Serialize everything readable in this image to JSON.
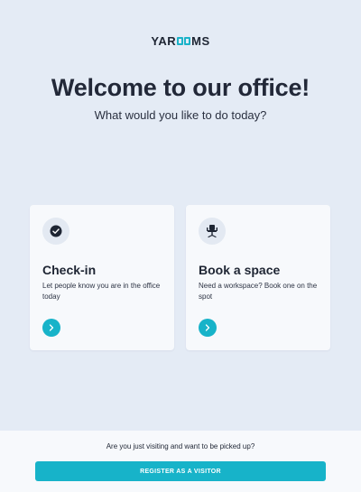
{
  "brand": {
    "logo_left": "YAR",
    "logo_right": "MS",
    "accent_color": "#17b3c9"
  },
  "hero": {
    "title": "Welcome to our office!",
    "subtitle": "What would you like to do today?"
  },
  "cards": [
    {
      "icon": "check-circle-icon",
      "title": "Check-in",
      "description": "Let people know you are in the office today",
      "action_icon": "chevron-right-icon"
    },
    {
      "icon": "office-chair-icon",
      "title": "Book a space",
      "description": "Need a workspace? Book one on the spot",
      "action_icon": "chevron-right-icon"
    }
  ],
  "footer": {
    "visit_text": "Are you just visiting and want to be picked up?",
    "register_label": "REGISTER AS A VISITOR"
  }
}
